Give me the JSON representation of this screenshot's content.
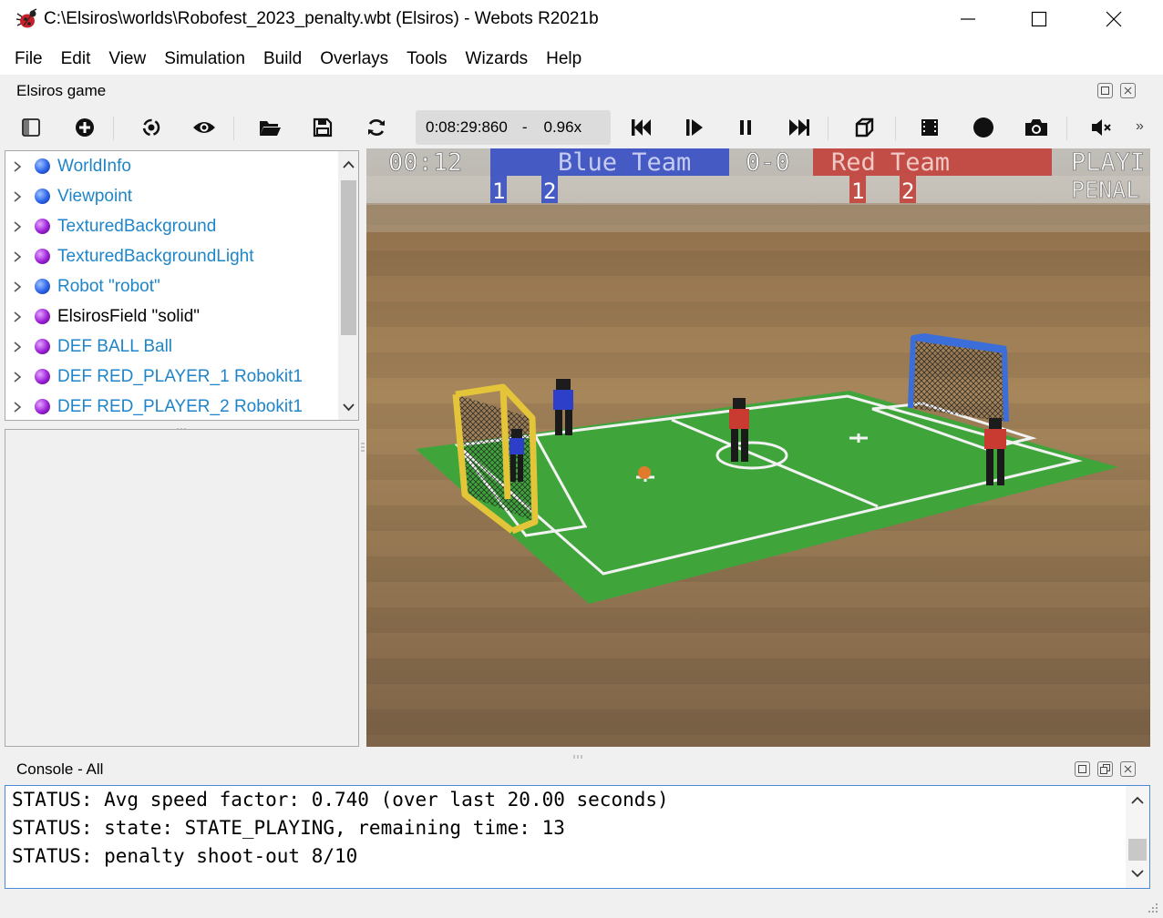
{
  "window": {
    "title": "C:\\Elsiros\\worlds\\Robofest_2023_penalty.wbt (Elsiros) - Webots R2021b",
    "controls": {
      "minimize": "—",
      "maximize": "☐",
      "close": "✕"
    }
  },
  "menu": [
    "File",
    "Edit",
    "View",
    "Simulation",
    "Build",
    "Overlays",
    "Tools",
    "Wizards",
    "Help"
  ],
  "game_dock": {
    "title": "Elsiros game"
  },
  "toolbar": {
    "sim_time": "0:08:29:860",
    "separator": "-",
    "speed": "0.96x",
    "more": "»"
  },
  "scene_tree": {
    "items": [
      {
        "label": "WorldInfo",
        "ball": "blue",
        "link": true
      },
      {
        "label": "Viewpoint",
        "ball": "blue",
        "link": true
      },
      {
        "label": "TexturedBackground",
        "ball": "purple",
        "link": true
      },
      {
        "label": "TexturedBackgroundLight",
        "ball": "purple",
        "link": true
      },
      {
        "label": "Robot \"robot\"",
        "ball": "blue",
        "link": true
      },
      {
        "label": "ElsirosField \"solid\"",
        "ball": "purple",
        "link": false
      },
      {
        "label": "DEF BALL Ball",
        "ball": "purple",
        "link": true
      },
      {
        "label": "DEF RED_PLAYER_1 Robokit1",
        "ball": "purple",
        "link": true
      },
      {
        "label": "DEF RED_PLAYER_2 Robokit1",
        "ball": "purple",
        "link": true
      }
    ]
  },
  "scoreboard": {
    "time": "00:12",
    "blue_team": "Blue Team",
    "score": "0-0",
    "red_team": "Red Team",
    "state": "PLAYI",
    "sub_state": "PENAL",
    "blue_players": [
      "1",
      "2"
    ],
    "red_players": [
      "1",
      "2"
    ],
    "colors": {
      "blue": "#2f49c6",
      "red": "#c23a33"
    }
  },
  "console": {
    "title": "Console - All",
    "lines": [
      "STATUS: Avg speed factor: 0.740 (over last 20.00 seconds)",
      "STATUS: state: STATE_PLAYING, remaining time: 13",
      "STATUS: penalty shoot-out 8/10"
    ]
  }
}
